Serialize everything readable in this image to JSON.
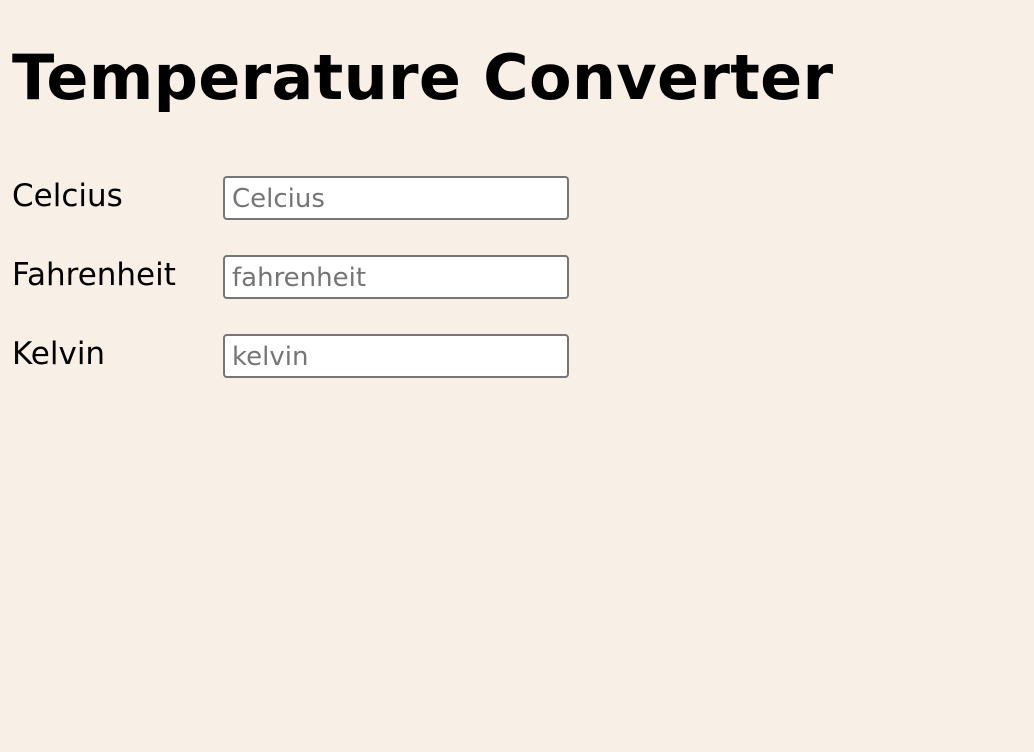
{
  "page": {
    "title": "Temperature Converter",
    "background_color": "#f8efe6"
  },
  "fields": [
    {
      "label": "Celcius",
      "placeholder": "Celcius",
      "value": ""
    },
    {
      "label": "Fahrenheit",
      "placeholder": "fahrenheit",
      "value": ""
    },
    {
      "label": "Kelvin",
      "placeholder": "kelvin",
      "value": ""
    }
  ]
}
